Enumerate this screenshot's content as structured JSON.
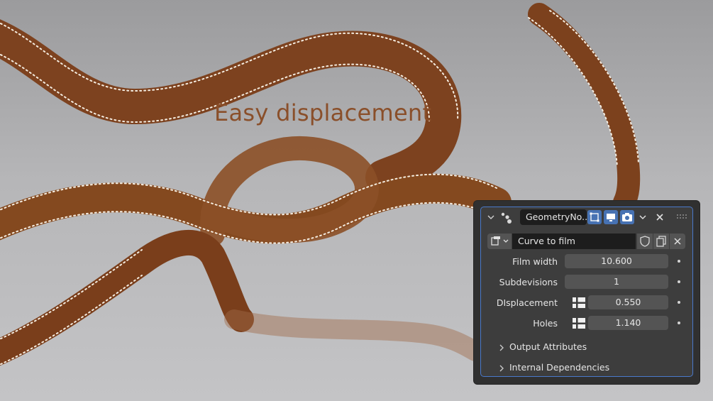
{
  "overlay": {
    "title": "Easy displacement"
  },
  "modifier": {
    "name": "GeometryNo...",
    "node_group": "Curve to film",
    "fields": [
      {
        "label": "Film width",
        "value": "10.600"
      },
      {
        "label": "Subdevisions",
        "value": "1"
      },
      {
        "label": "DIsplacement",
        "value": "0.550"
      },
      {
        "label": "Holes",
        "value": "1.140"
      }
    ],
    "sections": [
      {
        "label": "Output Attributes"
      },
      {
        "label": "Internal Dependencies"
      }
    ],
    "icons": {
      "collapse": "chevron-down-icon",
      "modifier_type": "geometry-nodes-icon",
      "edit_mode": "edit-mode-icon",
      "viewport": "monitor-icon",
      "render": "camera-icon",
      "menu": "chevron-down-icon",
      "remove": "close-icon",
      "drag": "drag-handle-icon",
      "browse": "node-tree-icon",
      "fake_user": "shield-icon",
      "duplicate": "duplicate-icon",
      "unlink": "close-icon",
      "attribute_toggle": "attribute-toggle-icon",
      "section_expand": "chevron-right-icon"
    },
    "colors": {
      "accent": "#4772b3",
      "panel": "#3d3d3d",
      "field": "#545454",
      "title": "#8a4f2a"
    }
  }
}
